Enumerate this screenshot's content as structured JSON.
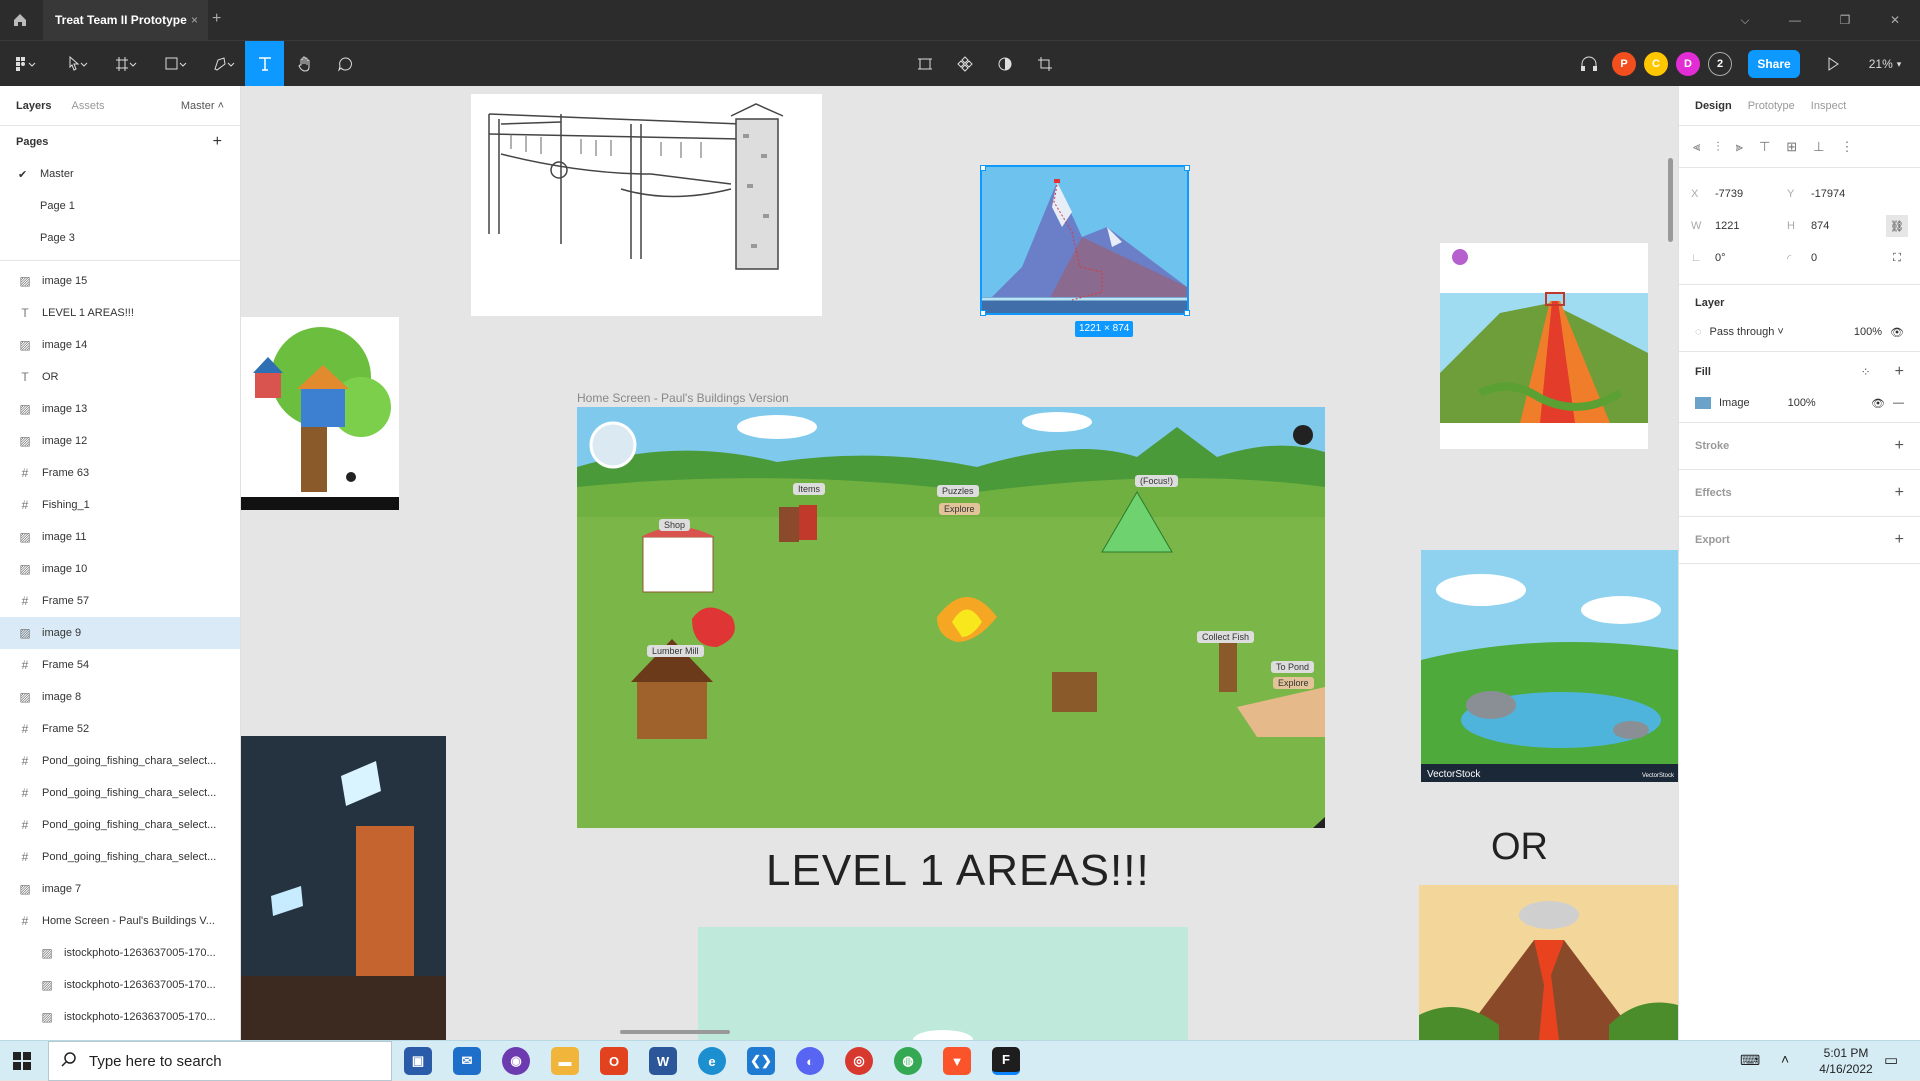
{
  "tabs": {
    "active_title": "Treat Team II Prototype",
    "close": "×",
    "new": "+"
  },
  "toolbar": {
    "avatars": [
      {
        "letter": "P",
        "color": "#f24e1e"
      },
      {
        "letter": "C",
        "color": "#ffc700"
      },
      {
        "letter": "D",
        "color": "#e12dd3"
      }
    ],
    "collab_count": "2",
    "share_label": "Share",
    "zoom": "21%"
  },
  "left_panel": {
    "tab_layers": "Layers",
    "tab_assets": "Assets",
    "page_switcher": "Master",
    "pages_title": "Pages",
    "pages": [
      "Master",
      "Page 1",
      "Page 3"
    ],
    "layers": [
      {
        "icon": "image",
        "name": "image 15"
      },
      {
        "icon": "text",
        "name": "LEVEL 1 AREAS!!!"
      },
      {
        "icon": "image",
        "name": "image 14"
      },
      {
        "icon": "text",
        "name": "OR"
      },
      {
        "icon": "image",
        "name": "image 13"
      },
      {
        "icon": "image",
        "name": "image 12"
      },
      {
        "icon": "frame",
        "name": "Frame 63"
      },
      {
        "icon": "frame",
        "name": "Fishing_1"
      },
      {
        "icon": "image",
        "name": "image 11"
      },
      {
        "icon": "image",
        "name": "image 10"
      },
      {
        "icon": "frame",
        "name": "Frame 57"
      },
      {
        "icon": "image",
        "name": "image 9",
        "selected": true
      },
      {
        "icon": "frame",
        "name": "Frame 54"
      },
      {
        "icon": "image",
        "name": "image 8"
      },
      {
        "icon": "frame",
        "name": "Frame 52"
      },
      {
        "icon": "frame",
        "name": "Pond_going_fishing_chara_select..."
      },
      {
        "icon": "frame",
        "name": "Pond_going_fishing_chara_select..."
      },
      {
        "icon": "frame",
        "name": "Pond_going_fishing_chara_select..."
      },
      {
        "icon": "frame",
        "name": "Pond_going_fishing_chara_select..."
      },
      {
        "icon": "image",
        "name": "image 7"
      },
      {
        "icon": "frame",
        "name": "Home Screen - Paul's Buildings V..."
      },
      {
        "icon": "image",
        "name": "istockphoto-1263637005-170...",
        "child": true
      },
      {
        "icon": "image",
        "name": "istockphoto-1263637005-170...",
        "child": true
      },
      {
        "icon": "image",
        "name": "istockphoto-1263637005-170...",
        "child": true
      }
    ]
  },
  "canvas": {
    "frame_label": "Home Screen - Paul's Buildings Version",
    "selection_size": "1221 × 874",
    "heading": "LEVEL 1 AREAS!!!",
    "or_text": "OR",
    "home_labels": {
      "shop": "Shop",
      "items": "Items",
      "puzzles": "Puzzles",
      "explore": "Explore",
      "focus": "(Focus!)",
      "lumber_mill": "Lumber Mill",
      "collect_fish": "Collect Fish",
      "to_pond": "To Pond",
      "explore2": "Explore"
    },
    "watermark_vs": "VectorStock",
    "watermark_vs_small": "VectorStock"
  },
  "right_panel": {
    "tab_design": "Design",
    "tab_prototype": "Prototype",
    "tab_inspect": "Inspect",
    "x_label": "X",
    "x": "-7739",
    "y_label": "Y",
    "y": "-17974",
    "w_label": "W",
    "w": "1221",
    "h_label": "H",
    "h": "874",
    "rotation": "0°",
    "radius": "0",
    "layer_title": "Layer",
    "blend": "Pass through",
    "opacity": "100%",
    "fill_title": "Fill",
    "fill_type": "Image",
    "fill_opacity": "100%",
    "stroke_title": "Stroke",
    "effects_title": "Effects",
    "export_title": "Export"
  },
  "taskbar": {
    "search_placeholder": "Type here to search",
    "time": "5:01 PM",
    "date": "4/16/2022"
  }
}
